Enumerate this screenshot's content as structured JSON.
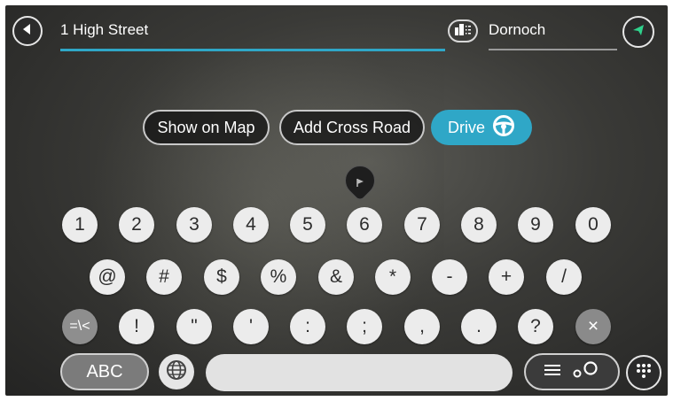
{
  "search": {
    "street_value": "1 High Street",
    "place_value": "Dornoch"
  },
  "actions": {
    "show_on_map": "Show on Map",
    "add_cross_road": "Add Cross Road",
    "drive": "Drive"
  },
  "keyboard": {
    "row1": [
      "1",
      "2",
      "3",
      "4",
      "5",
      "6",
      "7",
      "8",
      "9",
      "0"
    ],
    "row2": [
      "@",
      "#",
      "$",
      "%",
      "&",
      "*",
      "-",
      "+",
      "/"
    ],
    "row3_toggle": "=\\<",
    "row3": [
      "!",
      "\"",
      "'",
      ":",
      ";",
      ",",
      ".",
      "?"
    ],
    "backspace": "×",
    "abc": "ABC"
  },
  "icons": {
    "back": "back-arrow-icon",
    "place": "city-icon",
    "go": "navigation-arrow-icon",
    "steering": "steering-wheel-icon",
    "globe": "globe-icon",
    "list_search": "list-search-icon",
    "keyboard": "keyboard-icon",
    "pin": "map-pin-icon"
  },
  "colors": {
    "accent": "#2fa7c7",
    "key_light": "#ececec",
    "key_dark": "#8e8e8e"
  }
}
